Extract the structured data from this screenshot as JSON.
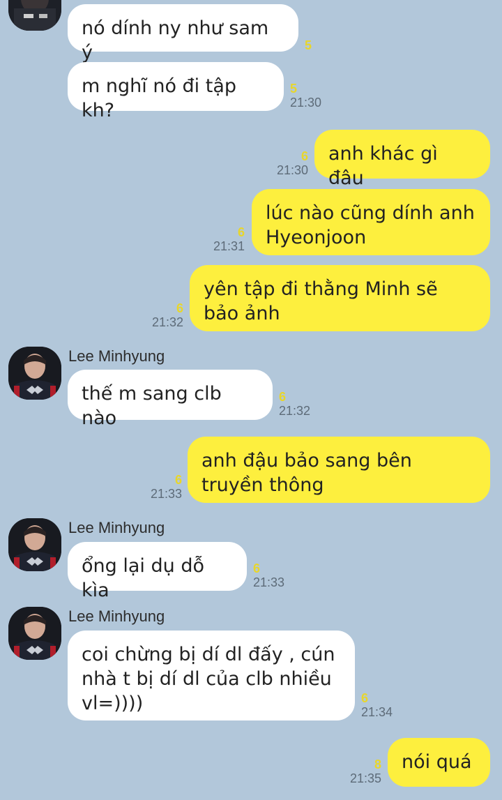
{
  "contact_name": "Lee Minhyung",
  "messages": [
    {
      "text": "nó dính ny như sam ý",
      "count": "5",
      "time": ""
    },
    {
      "text": "m nghĩ nó đi tập kh?",
      "count": "5",
      "time": "21:30"
    },
    {
      "text": "anh khác gì đâu",
      "count": "6",
      "time": "21:30"
    },
    {
      "text": "lúc nào cũng dính anh Hyeonjoon",
      "count": "6",
      "time": "21:31"
    },
    {
      "text": "yên tập đi thằng Minh sẽ bảo ảnh",
      "count": "6",
      "time": "21:32"
    },
    {
      "text": "thế m sang clb nào",
      "count": "6",
      "time": "21:32"
    },
    {
      "text": "anh đậu bảo sang bên truyền thông",
      "count": "6",
      "time": "21:33"
    },
    {
      "text": "ổng lại dụ dỗ kìa",
      "count": "6",
      "time": "21:33"
    },
    {
      "text": "coi chừng bị dí dl đấy , cún nhà t bị dí dl của clb nhiều vl=))))",
      "count": "6",
      "time": "21:34"
    },
    {
      "text": "nói quá",
      "count": "8",
      "time": "21:35"
    }
  ]
}
